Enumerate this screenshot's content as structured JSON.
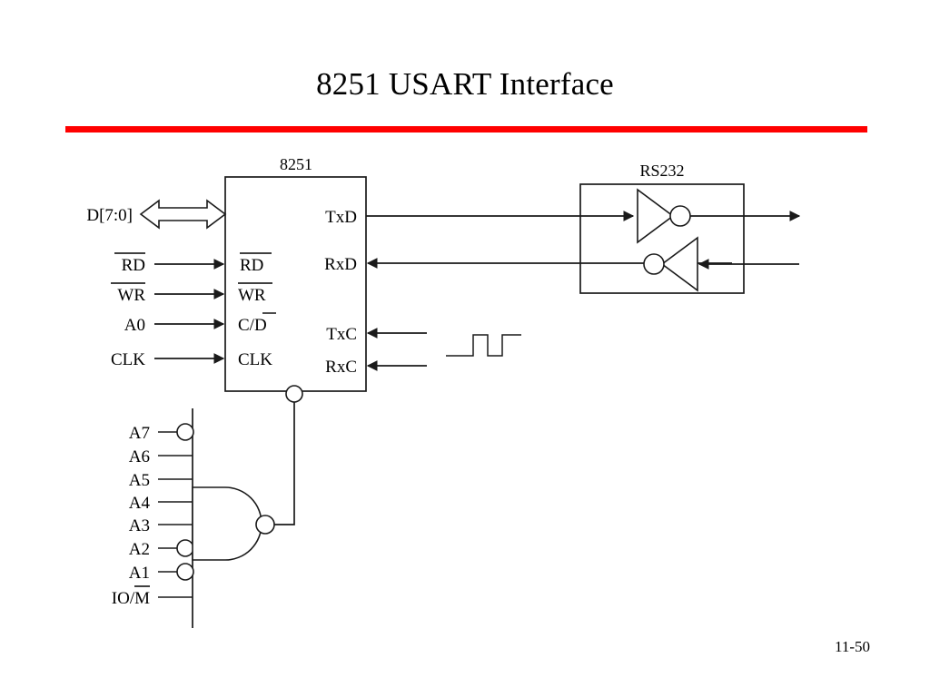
{
  "slide": {
    "title": "8251 USART Interface",
    "page_number": "11-50",
    "accent_color": "#ff0000",
    "ink_color": "#1a1a1a"
  },
  "chip": {
    "caption": "8251",
    "left_pins": [
      {
        "label": "RD",
        "overbar": "full"
      },
      {
        "label": "WR",
        "overbar": "full"
      },
      {
        "label": "C/D",
        "overbar": "last"
      },
      {
        "label": "CLK",
        "overbar": "none"
      }
    ],
    "right_pins": [
      {
        "label": "TxD"
      },
      {
        "label": "RxD"
      },
      {
        "label": "TxC"
      },
      {
        "label": "RxC"
      }
    ],
    "chip_select": "cs-bubble"
  },
  "external_inputs": {
    "bus_label": "D[7:0]",
    "signals": [
      {
        "label": "RD",
        "overbar": "full"
      },
      {
        "label": "WR",
        "overbar": "full"
      },
      {
        "label": "A0",
        "overbar": "none"
      },
      {
        "label": "CLK",
        "overbar": "none"
      }
    ]
  },
  "rs232": {
    "caption": "RS232",
    "drivers": [
      {
        "name": "tx-line-driver",
        "direction": "out"
      },
      {
        "name": "rx-line-receiver",
        "direction": "in"
      }
    ]
  },
  "clock_waveform": {
    "name": "clock-waveform-symbol"
  },
  "address_decoder": {
    "gate_type": "NAND",
    "inputs": [
      {
        "label": "A7",
        "inverted": true,
        "overbar": "none"
      },
      {
        "label": "A6",
        "inverted": false,
        "overbar": "none"
      },
      {
        "label": "A5",
        "inverted": false,
        "overbar": "none"
      },
      {
        "label": "A4",
        "inverted": false,
        "overbar": "none"
      },
      {
        "label": "A3",
        "inverted": false,
        "overbar": "none"
      },
      {
        "label": "A2",
        "inverted": true,
        "overbar": "none"
      },
      {
        "label": "A1",
        "inverted": true,
        "overbar": "none"
      },
      {
        "label": "IO/M",
        "inverted": false,
        "overbar": "last"
      }
    ]
  }
}
